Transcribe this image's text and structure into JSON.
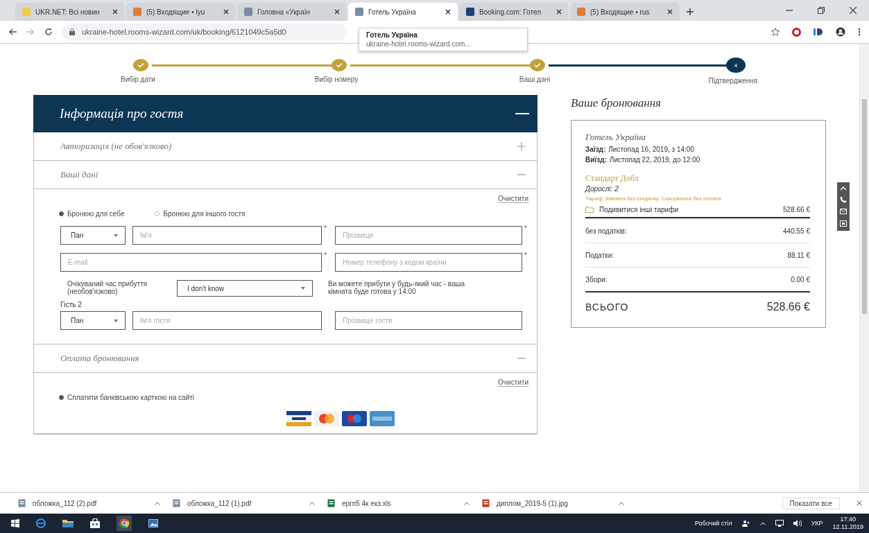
{
  "browser": {
    "tabs": [
      {
        "title": "UKR.NET: Всі новин",
        "selected": false,
        "color": "#f2c94c"
      },
      {
        "title": "(5) Входящие • lyu",
        "selected": false,
        "color": "#e07b39"
      },
      {
        "title": "Головна «Україн",
        "selected": false,
        "color": "#7a8aa0"
      },
      {
        "title": "Готель Україна",
        "selected": true,
        "color": "#7a8aa0"
      },
      {
        "title": "Booking.com: Готел",
        "selected": false,
        "color": "#1f3f7a"
      },
      {
        "title": "(5) Входящие • rus",
        "selected": false,
        "color": "#e07b39"
      }
    ],
    "url": "ukraine-hotel.rooms-wizard.com/uk/booking/6121049c5a5d0",
    "tooltip": {
      "title": "Готель Україна",
      "url": "ukraine-hotel.rooms-wizard.com..."
    }
  },
  "steps": [
    {
      "label": "Вибір дати",
      "completed": true,
      "selected": false
    },
    {
      "label": "Вибір номеру",
      "completed": true,
      "selected": false
    },
    {
      "label": "Ваші дані",
      "completed": true,
      "selected": false
    },
    {
      "label": "Підтвердження",
      "completed": false,
      "selected": true,
      "number": "4"
    }
  ],
  "guest_form": {
    "title": "Інформація про гостя",
    "expanded": true,
    "sections": [
      {
        "title": "Авторизація (не обов'язково)",
        "expanded": false
      },
      {
        "title": "Ваші дані",
        "expanded": true,
        "clear": "Очистити",
        "radios": [
          {
            "label": "Бронюю для себе",
            "selected": true
          },
          {
            "label": "Бронюю для іншого гостя",
            "selected": false
          }
        ],
        "rows": [
          {
            "kind": "fields",
            "items": [
              {
                "kind": "select",
                "value": "Пан"
              },
              {
                "kind": "input",
                "placeholder": "Ім'я",
                "required_mark": "*"
              },
              {
                "kind": "input",
                "placeholder": "Прізвище",
                "required_mark": "*"
              }
            ]
          },
          {
            "kind": "fields",
            "items": [
              {
                "kind": "input",
                "placeholder": "E-mail",
                "required_mark": "*"
              },
              {
                "kind": "input",
                "placeholder": "Номер телефону з кодом країни",
                "required_mark": "*"
              }
            ]
          },
          {
            "kind": "arrival",
            "label": "Очікуваний час прибуття (необов'язково)",
            "value": "I don't know",
            "note": "Ви можете прибути у будь-який час - ваша кімната буде готова у 14:00"
          },
          {
            "kind": "heading",
            "text": "Гість 2"
          },
          {
            "kind": "fields",
            "items": [
              {
                "kind": "select",
                "value": "Пан"
              },
              {
                "kind": "input",
                "placeholder": "Ім'я гостя"
              },
              {
                "kind": "input",
                "placeholder": "Прізвище гостя"
              }
            ]
          }
        ]
      },
      {
        "title": "Оплата бронювання",
        "expanded": true,
        "clear": "Очистити",
        "radios": [
          {
            "label": "Сплатити банківською карткою на сайті",
            "selected": true
          }
        ],
        "cards": [
          {
            "kind": "visa"
          },
          {
            "kind": "mastercard"
          },
          {
            "kind": "maestro"
          },
          {
            "kind": "amex"
          }
        ]
      }
    ]
  },
  "summary": {
    "title": "Ваше бронювання",
    "hotel": "Готель Україна",
    "dates": [
      {
        "label": "Заїзд:",
        "value": "Листопад 16, 2019, з 14:00"
      },
      {
        "label": "Виїзд:",
        "value": "Листопад 22, 2019, до 12:00"
      }
    ],
    "room": "Стандарт Добл",
    "guests": "Дорослі: 2",
    "rate": "Тариф: Кімната без сніданку. Скасування без оплати",
    "rates_link": "Подивитися інші тарифи",
    "room_price": "528.66 €",
    "lines": [
      {
        "label": "без податків:",
        "value": "440.55 €"
      },
      {
        "label": "Податки:",
        "value": "88.11 €"
      },
      {
        "label": "Збори:",
        "value": "0.00 €"
      }
    ],
    "total_label": "ВСЬОГО",
    "total": "528.66 €"
  },
  "downloads": {
    "files": [
      {
        "name": "обложка_112 (2).pdf",
        "kind": "pdf"
      },
      {
        "name": "обложка_112 (1).pdf",
        "kind": "pdf"
      },
      {
        "name": "ергп5 4к екз.xls",
        "kind": "sheet"
      },
      {
        "name": "диплом_2019-5 (1).jpg",
        "kind": "image"
      }
    ],
    "show_all": "Показати все"
  },
  "taskbar": {
    "desktop": "Робочий стіл",
    "language": "УКР",
    "time": "17:40",
    "date": "12.11.2019"
  }
}
